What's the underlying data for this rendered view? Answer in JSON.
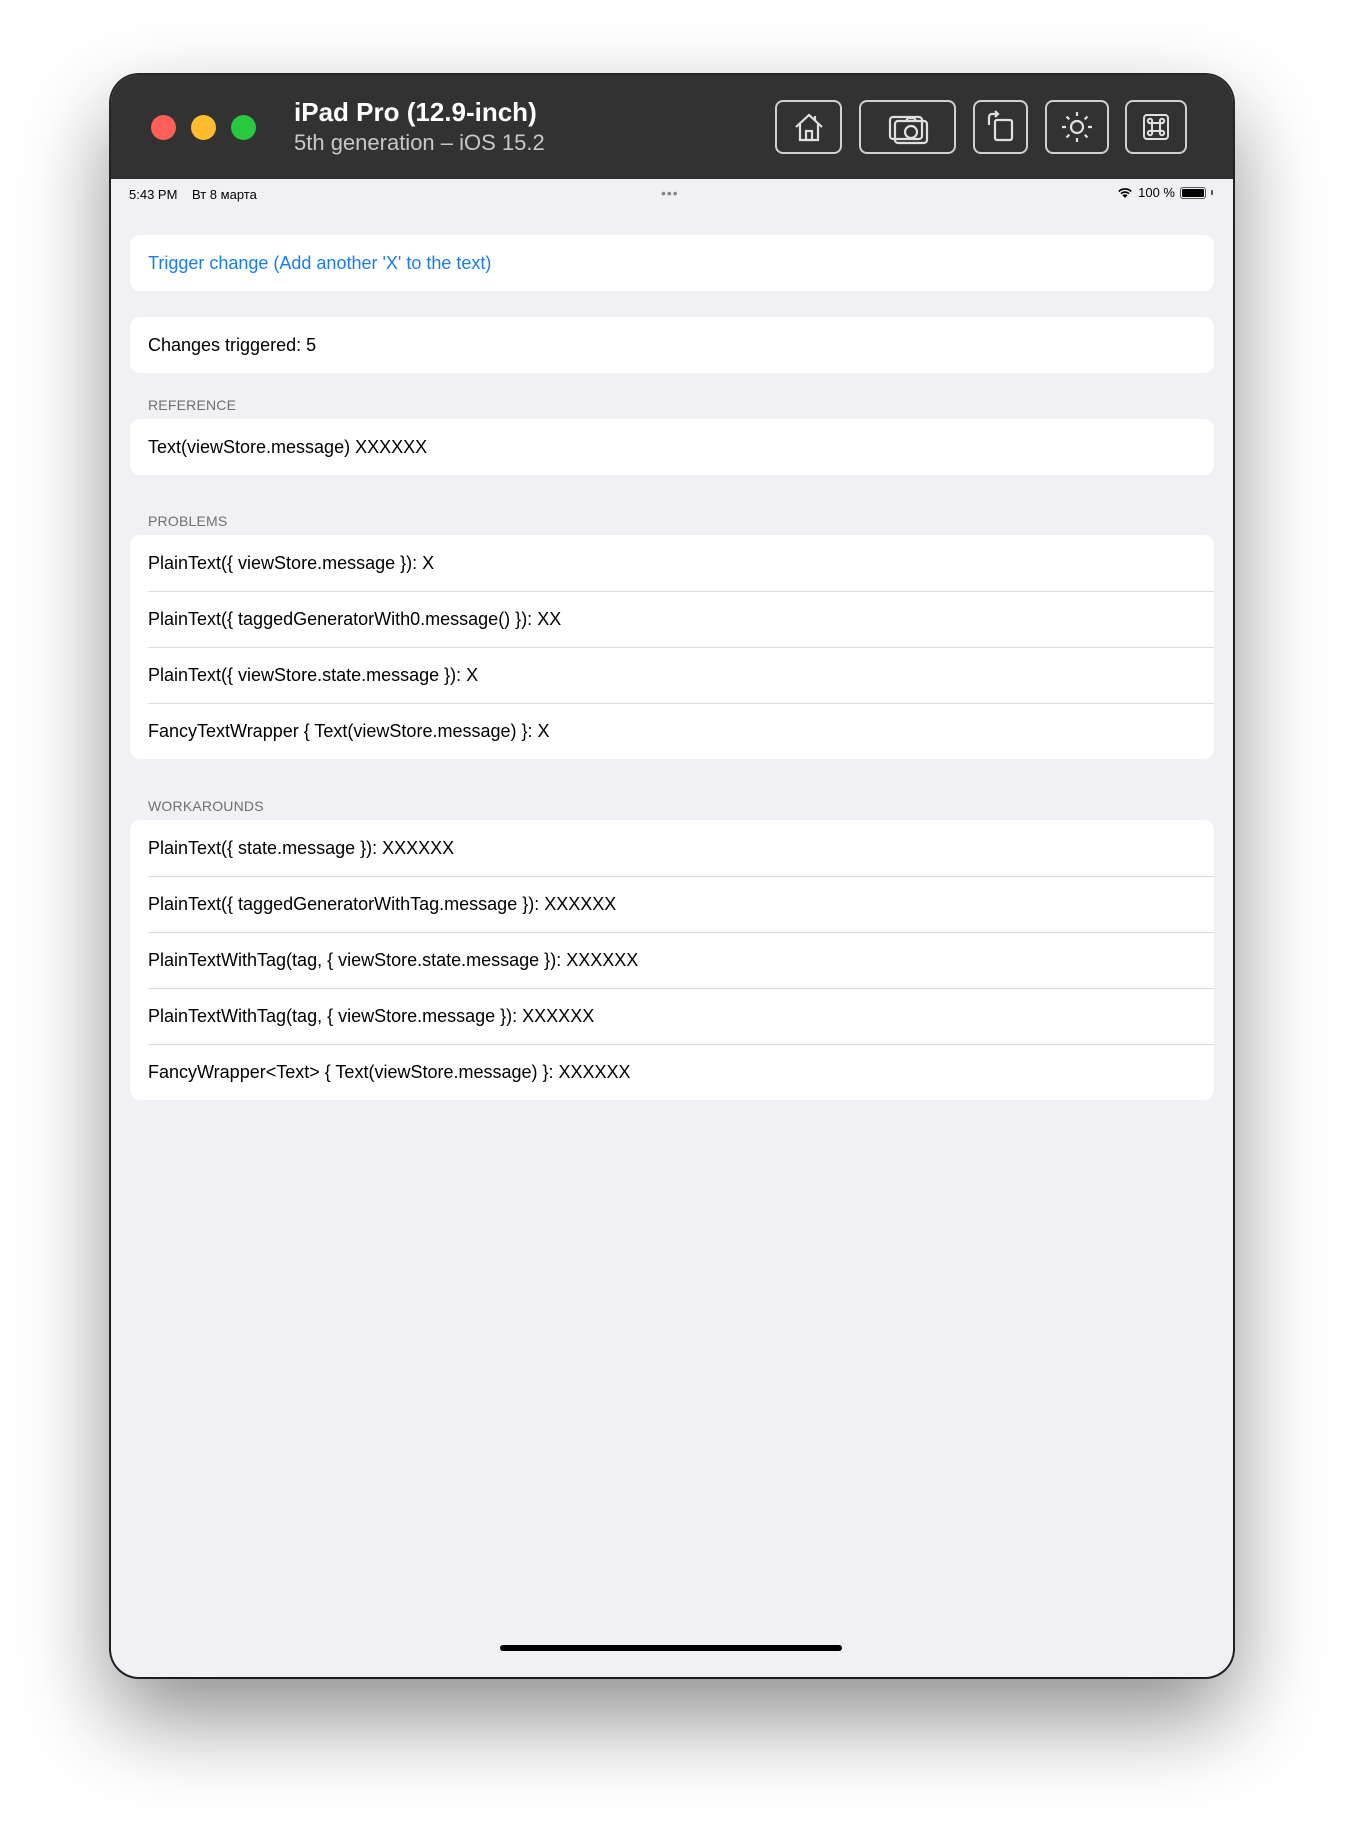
{
  "window": {
    "device_title": "iPad Pro (12.9-inch)",
    "device_subtitle": "5th generation – iOS 15.2",
    "toolbar_icons": [
      "home-icon",
      "screenshot-icon",
      "rotate-icon",
      "appearance-icon",
      "command-icon"
    ]
  },
  "statusbar": {
    "time": "5:43 PM",
    "date": "Вт 8 марта",
    "dots": "•••",
    "battery": "100 %"
  },
  "trigger": {
    "label": "Trigger change (Add another 'X' to the text)"
  },
  "counter": {
    "label": "Changes triggered: 5"
  },
  "reference": {
    "header": "REFERENCE",
    "rows": [
      "Text(viewStore.message)  XXXXXX"
    ]
  },
  "problems": {
    "header": "PROBLEMS",
    "rows": [
      "PlainText({ viewStore.message }):  X",
      "PlainText({ taggedGeneratorWith0.message() }):  XX",
      "PlainText({ viewStore.state.message }):  X",
      "FancyTextWrapper { Text(viewStore.message) }:  X"
    ]
  },
  "workarounds": {
    "header": "WORKAROUNDS",
    "rows": [
      "PlainText({ state.message }):  XXXXXX",
      "PlainText({ taggedGeneratorWithTag.message }):  XXXXXX",
      "PlainTextWithTag(tag, { viewStore.state.message }):  XXXXXX",
      "PlainTextWithTag(tag, { viewStore.message }):  XXXXXX",
      "FancyWrapper<Text> { Text(viewStore.message) }:  XXXXXX"
    ]
  },
  "colors": {
    "accent": "#1a7cf0",
    "background": "#f0f0f5",
    "titlebar": "#323232"
  }
}
